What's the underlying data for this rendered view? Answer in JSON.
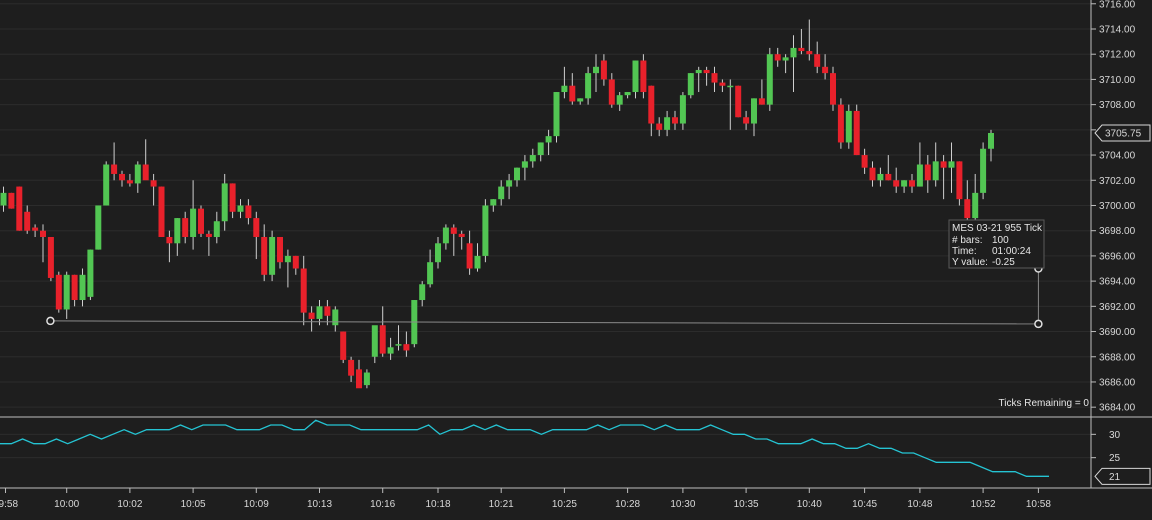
{
  "chart_data": [
    {
      "type": "candlestick",
      "instrument": "MES 03-21",
      "bar_type": "955 Tick",
      "ylim": [
        3683.3,
        3716.3
      ],
      "yticks": [
        "3716.00",
        "3714.00",
        "3712.00",
        "3710.00",
        "3708.00",
        "3706.00",
        "3704.00",
        "3702.00",
        "3700.00",
        "3698.00",
        "3696.00",
        "3694.00",
        "3692.00",
        "3690.00",
        "3688.00",
        "3686.00",
        "3684.00"
      ],
      "ytick_values": [
        3716,
        3714,
        3712,
        3710,
        3708,
        3706,
        3704,
        3702,
        3700,
        3698,
        3696,
        3694,
        3692,
        3690,
        3688,
        3686,
        3684
      ],
      "last_price": "3705.75",
      "last_price_value": 3705.75,
      "colors": {
        "up": "#52c653",
        "down": "#e8212b",
        "wick": "#cfcfcf",
        "background": "#1e1e1e",
        "grid": "#2c2c2c",
        "ruler": "#8a8a8a"
      },
      "candles": [
        {
          "o": 3700.0,
          "h": 3701.5,
          "l": 3699.5,
          "c": 3701.0
        },
        {
          "o": 3701.0,
          "h": 3701.0,
          "l": 3699.75,
          "c": 3699.75
        },
        {
          "o": 3701.5,
          "h": 3701.5,
          "l": 3698.0,
          "c": 3698.0
        },
        {
          "o": 3699.5,
          "h": 3700.0,
          "l": 3697.75,
          "c": 3698.0
        },
        {
          "o": 3698.25,
          "h": 3698.5,
          "l": 3697.5,
          "c": 3698.0
        },
        {
          "o": 3698.0,
          "h": 3698.5,
          "l": 3695.5,
          "c": 3697.5
        },
        {
          "o": 3697.5,
          "h": 3697.5,
          "l": 3694.0,
          "c": 3694.25
        },
        {
          "o": 3694.5,
          "h": 3694.75,
          "l": 3691.5,
          "c": 3691.75
        },
        {
          "o": 3691.75,
          "h": 3694.75,
          "l": 3691.0,
          "c": 3694.5
        },
        {
          "o": 3694.5,
          "h": 3694.5,
          "l": 3692.0,
          "c": 3692.5
        },
        {
          "o": 3692.5,
          "h": 3695.0,
          "l": 3692.0,
          "c": 3694.5
        },
        {
          "o": 3692.75,
          "h": 3696.5,
          "l": 3692.5,
          "c": 3696.5
        },
        {
          "o": 3696.5,
          "h": 3700.0,
          "l": 3696.5,
          "c": 3700.0
        },
        {
          "o": 3700.0,
          "h": 3703.5,
          "l": 3700.0,
          "c": 3703.25
        },
        {
          "o": 3703.25,
          "h": 3705.0,
          "l": 3702.0,
          "c": 3702.5
        },
        {
          "o": 3702.5,
          "h": 3702.75,
          "l": 3701.5,
          "c": 3702.0
        },
        {
          "o": 3702.0,
          "h": 3702.5,
          "l": 3701.5,
          "c": 3701.75
        },
        {
          "o": 3701.75,
          "h": 3703.5,
          "l": 3701.0,
          "c": 3703.25
        },
        {
          "o": 3703.25,
          "h": 3705.25,
          "l": 3702.5,
          "c": 3702.0
        },
        {
          "o": 3702.0,
          "h": 3702.5,
          "l": 3700.0,
          "c": 3701.5
        },
        {
          "o": 3701.5,
          "h": 3701.5,
          "l": 3697.5,
          "c": 3697.5
        },
        {
          "o": 3697.5,
          "h": 3698.0,
          "l": 3695.5,
          "c": 3697.0
        },
        {
          "o": 3697.0,
          "h": 3699.0,
          "l": 3696.0,
          "c": 3699.0
        },
        {
          "o": 3699.0,
          "h": 3699.5,
          "l": 3697.0,
          "c": 3697.5
        },
        {
          "o": 3697.5,
          "h": 3702.0,
          "l": 3696.5,
          "c": 3699.75
        },
        {
          "o": 3699.75,
          "h": 3700.0,
          "l": 3697.5,
          "c": 3697.75
        },
        {
          "o": 3697.75,
          "h": 3698.0,
          "l": 3696.0,
          "c": 3697.5
        },
        {
          "o": 3697.5,
          "h": 3699.5,
          "l": 3697.0,
          "c": 3698.75
        },
        {
          "o": 3698.75,
          "h": 3702.5,
          "l": 3698.0,
          "c": 3701.75
        },
        {
          "o": 3701.75,
          "h": 3701.75,
          "l": 3699.0,
          "c": 3699.5
        },
        {
          "o": 3699.5,
          "h": 3700.5,
          "l": 3699.0,
          "c": 3700.0
        },
        {
          "o": 3700.0,
          "h": 3700.5,
          "l": 3698.5,
          "c": 3699.0
        },
        {
          "o": 3699.0,
          "h": 3699.5,
          "l": 3695.75,
          "c": 3697.5
        },
        {
          "o": 3697.5,
          "h": 3698.5,
          "l": 3694.0,
          "c": 3694.5
        },
        {
          "o": 3694.5,
          "h": 3698.0,
          "l": 3694.0,
          "c": 3697.5
        },
        {
          "o": 3697.5,
          "h": 3697.5,
          "l": 3695.0,
          "c": 3695.5
        },
        {
          "o": 3695.5,
          "h": 3696.5,
          "l": 3693.5,
          "c": 3696.0
        },
        {
          "o": 3696.0,
          "h": 3696.0,
          "l": 3694.5,
          "c": 3695.0
        },
        {
          "o": 3695.0,
          "h": 3696.0,
          "l": 3690.5,
          "c": 3691.5
        },
        {
          "o": 3691.5,
          "h": 3692.0,
          "l": 3690.0,
          "c": 3691.0
        },
        {
          "o": 3691.0,
          "h": 3692.5,
          "l": 3690.5,
          "c": 3692.0
        },
        {
          "o": 3692.0,
          "h": 3692.5,
          "l": 3690.5,
          "c": 3691.25
        },
        {
          "o": 3690.5,
          "h": 3692.0,
          "l": 3690.0,
          "c": 3691.75
        },
        {
          "o": 3690.0,
          "h": 3690.0,
          "l": 3687.5,
          "c": 3687.75
        },
        {
          "o": 3687.75,
          "h": 3688.0,
          "l": 3686.0,
          "c": 3686.5
        },
        {
          "o": 3687.0,
          "h": 3687.75,
          "l": 3685.75,
          "c": 3685.5
        },
        {
          "o": 3685.75,
          "h": 3687.0,
          "l": 3685.5,
          "c": 3686.75
        },
        {
          "o": 3688.0,
          "h": 3690.0,
          "l": 3687.5,
          "c": 3690.5
        },
        {
          "o": 3690.5,
          "h": 3692.0,
          "l": 3688.0,
          "c": 3688.25
        },
        {
          "o": 3688.25,
          "h": 3689.5,
          "l": 3687.75,
          "c": 3688.75
        },
        {
          "o": 3689.0,
          "h": 3690.5,
          "l": 3688.5,
          "c": 3689.0
        },
        {
          "o": 3689.0,
          "h": 3690.0,
          "l": 3688.0,
          "c": 3688.5
        },
        {
          "o": 3689.0,
          "h": 3692.5,
          "l": 3688.75,
          "c": 3692.5
        },
        {
          "o": 3692.5,
          "h": 3694.0,
          "l": 3692.0,
          "c": 3693.75
        },
        {
          "o": 3693.75,
          "h": 3696.5,
          "l": 3693.5,
          "c": 3695.5
        },
        {
          "o": 3695.5,
          "h": 3697.5,
          "l": 3695.0,
          "c": 3697.0
        },
        {
          "o": 3697.0,
          "h": 3698.5,
          "l": 3696.5,
          "c": 3698.25
        },
        {
          "o": 3698.25,
          "h": 3698.5,
          "l": 3696.0,
          "c": 3697.75
        },
        {
          "o": 3697.75,
          "h": 3698.0,
          "l": 3696.5,
          "c": 3697.5
        },
        {
          "o": 3697.0,
          "h": 3698.0,
          "l": 3694.5,
          "c": 3695.0
        },
        {
          "o": 3695.0,
          "h": 3697.0,
          "l": 3694.75,
          "c": 3696.0
        },
        {
          "o": 3696.0,
          "h": 3700.5,
          "l": 3695.5,
          "c": 3700.0
        },
        {
          "o": 3700.0,
          "h": 3700.5,
          "l": 3699.5,
          "c": 3700.5
        },
        {
          "o": 3700.5,
          "h": 3702.0,
          "l": 3700.0,
          "c": 3701.5
        },
        {
          "o": 3701.5,
          "h": 3702.5,
          "l": 3700.5,
          "c": 3702.0
        },
        {
          "o": 3702.0,
          "h": 3703.0,
          "l": 3701.5,
          "c": 3703.0
        },
        {
          "o": 3703.0,
          "h": 3704.0,
          "l": 3702.0,
          "c": 3703.5
        },
        {
          "o": 3703.5,
          "h": 3704.5,
          "l": 3703.0,
          "c": 3704.0
        },
        {
          "o": 3704.0,
          "h": 3705.0,
          "l": 3703.5,
          "c": 3705.0
        },
        {
          "o": 3705.0,
          "h": 3706.0,
          "l": 3704.0,
          "c": 3705.5
        },
        {
          "o": 3705.5,
          "h": 3709.0,
          "l": 3705.0,
          "c": 3709.0
        },
        {
          "o": 3709.0,
          "h": 3711.0,
          "l": 3708.5,
          "c": 3709.5
        },
        {
          "o": 3709.5,
          "h": 3710.5,
          "l": 3708.0,
          "c": 3708.25
        },
        {
          "o": 3708.25,
          "h": 3708.5,
          "l": 3708.0,
          "c": 3708.5
        },
        {
          "o": 3708.5,
          "h": 3711.0,
          "l": 3708.0,
          "c": 3710.5
        },
        {
          "o": 3710.5,
          "h": 3712.0,
          "l": 3709.0,
          "c": 3711.0
        },
        {
          "o": 3711.5,
          "h": 3712.0,
          "l": 3709.5,
          "c": 3710.0
        },
        {
          "o": 3710.0,
          "h": 3710.5,
          "l": 3707.75,
          "c": 3708.0
        },
        {
          "o": 3708.0,
          "h": 3709.0,
          "l": 3707.5,
          "c": 3708.75
        },
        {
          "o": 3708.75,
          "h": 3709.0,
          "l": 3708.5,
          "c": 3709.0
        },
        {
          "o": 3709.0,
          "h": 3711.5,
          "l": 3708.5,
          "c": 3711.5
        },
        {
          "o": 3711.5,
          "h": 3712.0,
          "l": 3708.5,
          "c": 3709.0
        },
        {
          "o": 3709.5,
          "h": 3709.5,
          "l": 3705.5,
          "c": 3706.5
        },
        {
          "o": 3706.5,
          "h": 3707.0,
          "l": 3705.5,
          "c": 3706.0
        },
        {
          "o": 3706.0,
          "h": 3707.5,
          "l": 3705.5,
          "c": 3707.0
        },
        {
          "o": 3707.0,
          "h": 3707.5,
          "l": 3706.0,
          "c": 3706.5
        },
        {
          "o": 3706.5,
          "h": 3709.0,
          "l": 3706.0,
          "c": 3708.75
        },
        {
          "o": 3708.75,
          "h": 3710.5,
          "l": 3708.5,
          "c": 3710.5
        },
        {
          "o": 3710.5,
          "h": 3711.0,
          "l": 3709.0,
          "c": 3710.75
        },
        {
          "o": 3710.75,
          "h": 3711.0,
          "l": 3709.5,
          "c": 3710.5
        },
        {
          "o": 3710.5,
          "h": 3711.0,
          "l": 3709.0,
          "c": 3709.75
        },
        {
          "o": 3709.75,
          "h": 3710.0,
          "l": 3709.0,
          "c": 3709.5
        },
        {
          "o": 3709.5,
          "h": 3710.0,
          "l": 3706.0,
          "c": 3709.5
        },
        {
          "o": 3709.5,
          "h": 3709.5,
          "l": 3707.0,
          "c": 3707.0
        },
        {
          "o": 3707.0,
          "h": 3707.5,
          "l": 3706.0,
          "c": 3706.5
        },
        {
          "o": 3706.5,
          "h": 3708.5,
          "l": 3705.5,
          "c": 3708.5
        },
        {
          "o": 3708.5,
          "h": 3710.0,
          "l": 3708.0,
          "c": 3708.0
        },
        {
          "o": 3708.0,
          "h": 3712.5,
          "l": 3707.5,
          "c": 3712.0
        },
        {
          "o": 3712.0,
          "h": 3712.5,
          "l": 3711.0,
          "c": 3711.5
        },
        {
          "o": 3711.5,
          "h": 3712.0,
          "l": 3710.5,
          "c": 3711.75
        },
        {
          "o": 3711.75,
          "h": 3713.5,
          "l": 3709.0,
          "c": 3712.5
        },
        {
          "o": 3712.5,
          "h": 3714.0,
          "l": 3712.0,
          "c": 3712.25
        },
        {
          "o": 3712.25,
          "h": 3714.75,
          "l": 3711.5,
          "c": 3712.0
        },
        {
          "o": 3712.0,
          "h": 3713.0,
          "l": 3710.5,
          "c": 3711.0
        },
        {
          "o": 3711.0,
          "h": 3712.0,
          "l": 3710.0,
          "c": 3710.5
        },
        {
          "o": 3710.5,
          "h": 3711.0,
          "l": 3707.5,
          "c": 3708.0
        },
        {
          "o": 3708.0,
          "h": 3708.5,
          "l": 3704.5,
          "c": 3705.0
        },
        {
          "o": 3705.0,
          "h": 3708.0,
          "l": 3704.5,
          "c": 3707.5
        },
        {
          "o": 3707.5,
          "h": 3708.0,
          "l": 3704.0,
          "c": 3704.0
        },
        {
          "o": 3704.0,
          "h": 3704.5,
          "l": 3702.5,
          "c": 3703.0
        },
        {
          "o": 3703.0,
          "h": 3703.5,
          "l": 3701.5,
          "c": 3702.0
        },
        {
          "o": 3702.0,
          "h": 3703.0,
          "l": 3701.5,
          "c": 3702.5
        },
        {
          "o": 3702.5,
          "h": 3704.0,
          "l": 3702.0,
          "c": 3702.0
        },
        {
          "o": 3702.0,
          "h": 3703.0,
          "l": 3701.0,
          "c": 3701.5
        },
        {
          "o": 3701.5,
          "h": 3702.0,
          "l": 3701.0,
          "c": 3702.0
        },
        {
          "o": 3702.0,
          "h": 3702.5,
          "l": 3701.0,
          "c": 3701.5
        },
        {
          "o": 3701.5,
          "h": 3705.0,
          "l": 3701.5,
          "c": 3703.25
        },
        {
          "o": 3703.25,
          "h": 3704.0,
          "l": 3701.0,
          "c": 3702.0
        },
        {
          "o": 3702.0,
          "h": 3705.0,
          "l": 3701.5,
          "c": 3703.5
        },
        {
          "o": 3703.5,
          "h": 3704.0,
          "l": 3700.5,
          "c": 3703.0
        },
        {
          "o": 3703.0,
          "h": 3705.0,
          "l": 3701.0,
          "c": 3703.5
        },
        {
          "o": 3703.5,
          "h": 3703.5,
          "l": 3700.0,
          "c": 3700.5
        },
        {
          "o": 3700.5,
          "h": 3702.0,
          "l": 3698.5,
          "c": 3699.0
        },
        {
          "o": 3699.0,
          "h": 3702.5,
          "l": 3698.5,
          "c": 3701.0
        },
        {
          "o": 3701.0,
          "h": 3705.0,
          "l": 3700.5,
          "c": 3704.5
        },
        {
          "o": 3704.5,
          "h": 3706.0,
          "l": 3703.5,
          "c": 3705.75
        }
      ],
      "time_labels": [
        "09:58",
        "10:00",
        "10:02",
        "10:05",
        "10:09",
        "10:13",
        "10:16",
        "10:18",
        "10:21",
        "10:25",
        "10:28",
        "10:30",
        "10:35",
        "10:40",
        "10:45",
        "10:48",
        "10:52",
        "10:58"
      ],
      "time_label_bar_index": [
        0,
        8,
        16,
        24,
        32,
        40,
        48,
        55,
        63,
        71,
        79,
        86,
        94,
        102,
        109,
        116,
        124,
        131
      ]
    },
    {
      "type": "line",
      "name_label": "",
      "ylim": [
        18.5,
        33.5
      ],
      "yticks": [
        "30",
        "25"
      ],
      "ytick_values": [
        30,
        25
      ],
      "last_value": "21",
      "last_value_num": 21,
      "color": "#25c4d3",
      "values": [
        28,
        28,
        29,
        28,
        28,
        29,
        28,
        29,
        30,
        29,
        30,
        31,
        30,
        31,
        31,
        31,
        32,
        31,
        32,
        32,
        32,
        31,
        31,
        31,
        32,
        32,
        31,
        31,
        33,
        32,
        32,
        32,
        31,
        31,
        31,
        31,
        31,
        31,
        32,
        30,
        31,
        31,
        32,
        31,
        32,
        31,
        31,
        31,
        30,
        31,
        31,
        31,
        31,
        32,
        31,
        32,
        32,
        32,
        31,
        32,
        31,
        31,
        31,
        32,
        31,
        30,
        30,
        29,
        29,
        28,
        28,
        28,
        29,
        28,
        28,
        27,
        27,
        28,
        27,
        27,
        26,
        26,
        25,
        24,
        24,
        24,
        24,
        23,
        22,
        22,
        22,
        21,
        21,
        21
      ]
    }
  ],
  "info_box": {
    "line1": "MES 03-21 955 Tick",
    "bars_label": "# bars:",
    "bars_value": "100",
    "time_label": "Time:",
    "time_value": "01:00:24",
    "y_label": "Y value:",
    "y_value": "-0.25"
  },
  "ticks_remaining": "Ticks Remaining = 0",
  "ruler_measure": {
    "start_price": 3691.0,
    "end_price": 3695.0,
    "start_bar": 6,
    "end_bar": 131
  }
}
